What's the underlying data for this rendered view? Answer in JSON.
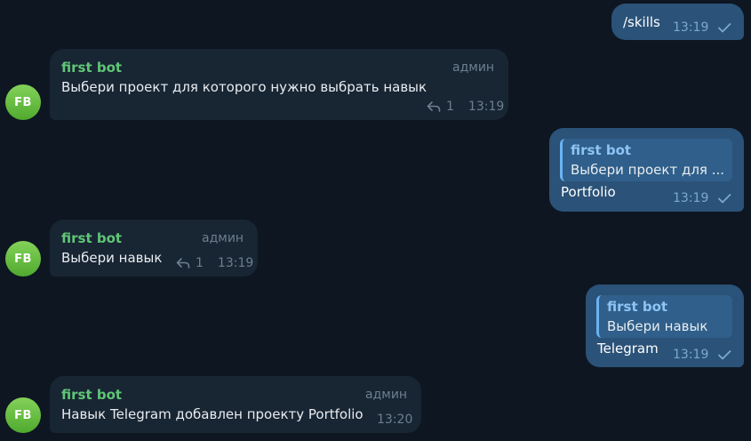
{
  "bot": {
    "name": "first bot",
    "avatar_initials": "FB",
    "role": "админ"
  },
  "messages": [
    {
      "direction": "outgoing",
      "text": "/skills",
      "time": "13:19",
      "read": true
    },
    {
      "direction": "incoming",
      "sender": "first bot",
      "role": "админ",
      "text": "Выбери проект для которого нужно выбрать навык",
      "replies": "1",
      "time": "13:19"
    },
    {
      "direction": "outgoing",
      "reply_to": {
        "sender": "first bot",
        "text": "Выбери проект для ..."
      },
      "text": "Portfolio",
      "time": "13:19",
      "read": true
    },
    {
      "direction": "incoming",
      "sender": "first bot",
      "role": "админ",
      "text": "Выбери навык",
      "replies": "1",
      "time": "13:19"
    },
    {
      "direction": "outgoing",
      "reply_to": {
        "sender": "first bot",
        "text": "Выбери навык"
      },
      "text": "Telegram",
      "time": "13:19",
      "read": true
    },
    {
      "direction": "incoming",
      "sender": "first bot",
      "role": "админ",
      "text": "Навык Telegram добавлен проекту Portfolio",
      "time": "13:20"
    }
  ],
  "colors": {
    "background": "#0e1621",
    "incoming_bubble": "#182533",
    "outgoing_bubble": "#2b5278",
    "sender_name": "#5fc676",
    "quote_name": "#8ec4f4",
    "check": "#7da8d3"
  },
  "icons": {
    "reply": "reply-arrow-icon",
    "read": "checkmark-icon"
  }
}
